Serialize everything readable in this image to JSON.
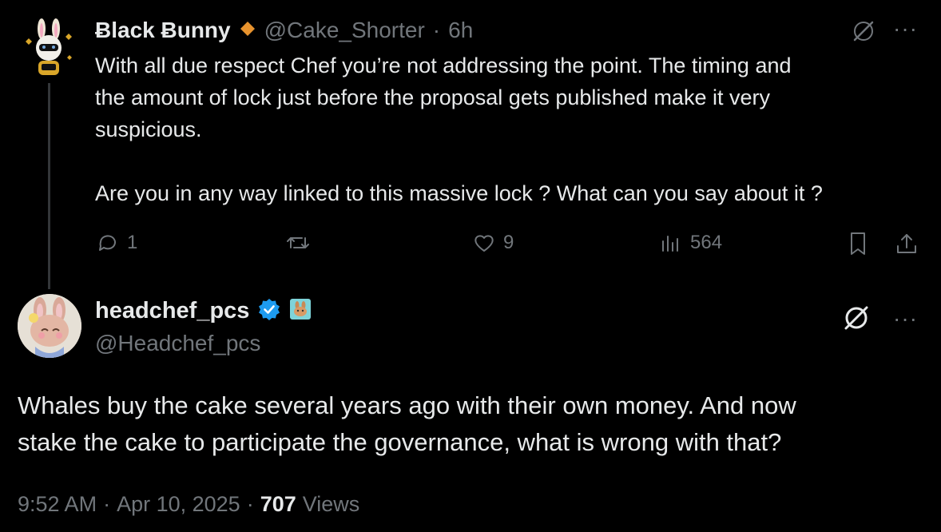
{
  "reply_tweet": {
    "display_name": "Ƀlack Ƀunny",
    "handle": "@Cake_Shorter",
    "separator": "·",
    "time": "6h",
    "text": "With all due respect Chef you’re not addressing the point. The timing and\nthe amount of lock just before the proposal gets published make it very\nsuspicious.\n\nAre you in any way linked to this massive lock ? What can you say about it ?",
    "actions": {
      "replies": "1",
      "retweets": "",
      "likes": "9",
      "views": "564"
    },
    "badge_color": "#e8932e"
  },
  "main_tweet": {
    "display_name": "headchef_pcs",
    "handle": "@Headchef_pcs",
    "text": "Whales buy the cake several years ago with their own money. And now\nstake the cake to participate the governance, what is wrong with that?",
    "time": "9:52 AM",
    "date": "Apr 10, 2025",
    "separator": "·",
    "views_count": "707",
    "views_label": "Views",
    "verified_color": "#1d9bf0"
  },
  "icons": {
    "grok": "grok-icon",
    "more": "more-icon",
    "reply": "reply-icon",
    "retweet": "retweet-icon",
    "like": "heart-icon",
    "views": "views-icon",
    "bookmark": "bookmark-icon",
    "share": "share-icon"
  }
}
